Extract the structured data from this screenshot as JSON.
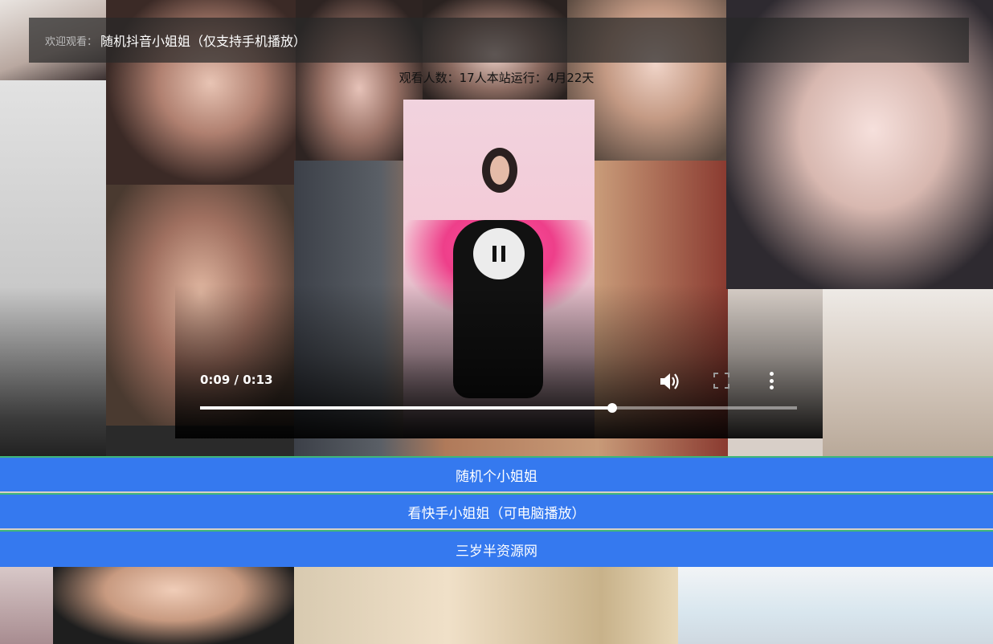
{
  "header": {
    "welcome_prefix": "欢迎观看：",
    "welcome_title": "随机抖音小姐姐（仅支持手机播放）"
  },
  "stats": {
    "text": "观看人数：17人本站运行：4月22天"
  },
  "player": {
    "time_display": "0:09 / 0:13",
    "progress_fraction": 0.69,
    "state": "playing"
  },
  "buttons": {
    "random": "随机个小姐姐",
    "kuaishou": "看快手小姐姐（可电脑播放）",
    "site": "三岁半资源网"
  },
  "colors": {
    "button_bg": "#3579ef",
    "button_divider": "#3fb57a"
  }
}
